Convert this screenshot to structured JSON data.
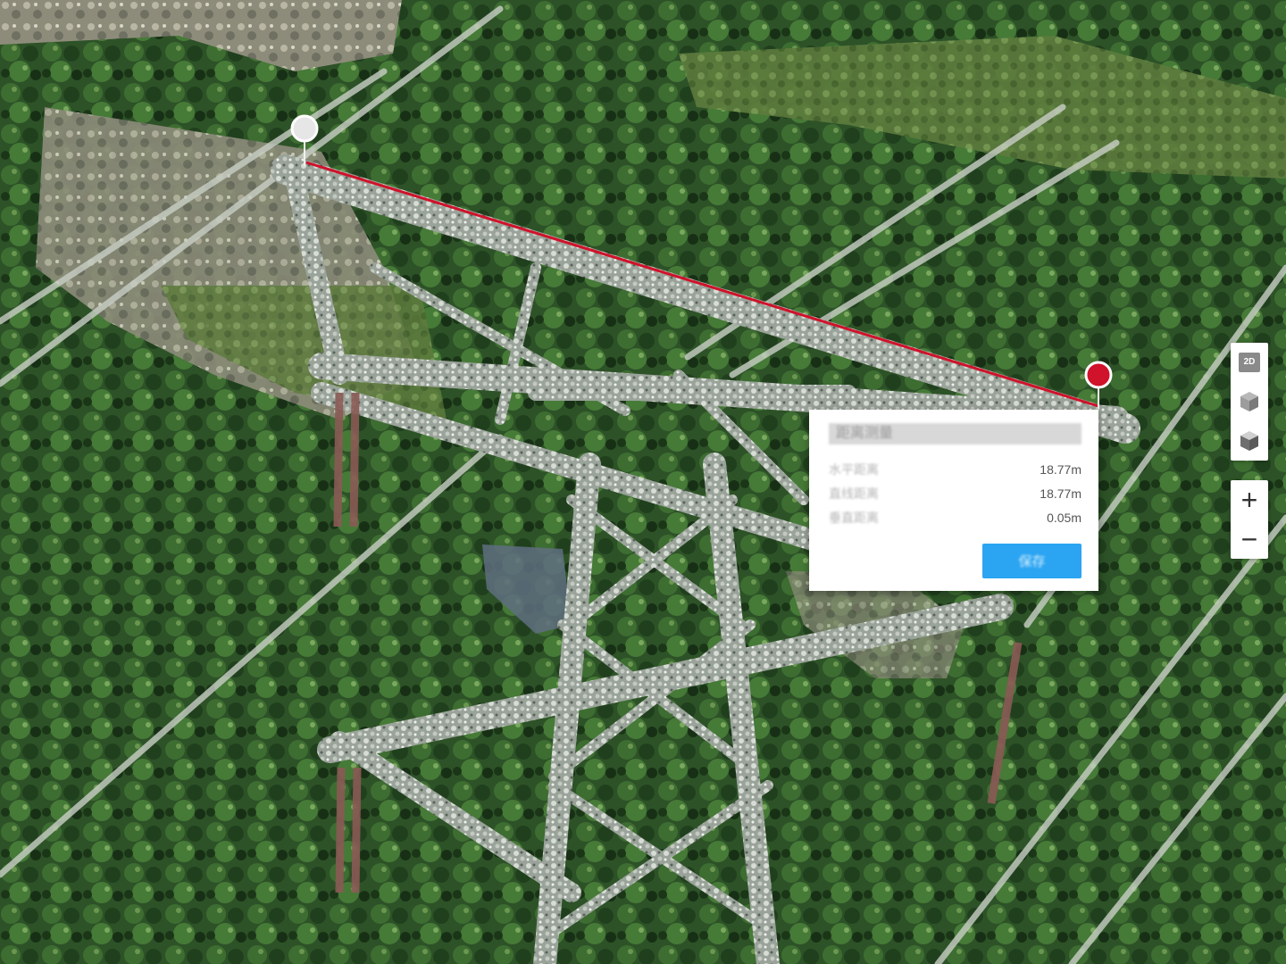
{
  "measure_panel": {
    "title": "距离测量",
    "rows": [
      {
        "label": "水平距离",
        "value": "18.77m"
      },
      {
        "label": "直线距离",
        "value": "18.77m"
      },
      {
        "label": "垂直距离",
        "value": "0.05m"
      }
    ],
    "save_label": "保存"
  },
  "view_controls": {
    "mode_2d_label": "2D",
    "mode_3d_icon": "cube-icon",
    "mode_3d_alt_icon": "cube-shaded-icon"
  },
  "zoom_controls": {
    "zoom_in_label": "+",
    "zoom_out_label": "−"
  },
  "colors": {
    "measure_line": "#d0122a",
    "end_marker": "#d0122a",
    "start_marker": "#e6e6e6",
    "save_button": "#2ba5f2",
    "vegetation": "#2f5a2a"
  }
}
